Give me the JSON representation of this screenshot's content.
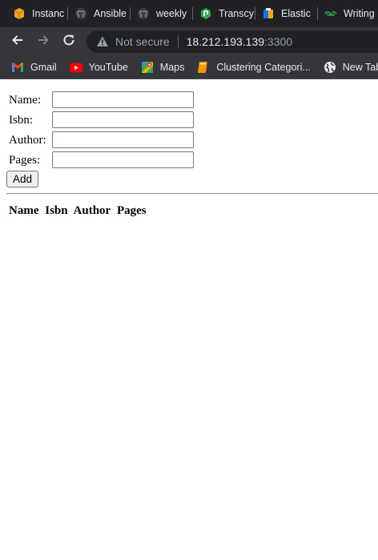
{
  "tabs": [
    {
      "label": "Instanc",
      "icon": "aws-box-icon"
    },
    {
      "label": "Ansible",
      "icon": "github-icon"
    },
    {
      "label": "weekly",
      "icon": "github-icon"
    },
    {
      "label": "Transcy",
      "icon": "transcy-icon"
    },
    {
      "label": "Elastic",
      "icon": "elastic-icon"
    },
    {
      "label": "Writing",
      "icon": "writing-icon"
    }
  ],
  "address": {
    "security_label": "Not secure",
    "host": "18.212.193.139",
    "port": ":3300"
  },
  "bookmarks": [
    {
      "label": "Gmail",
      "icon": "gmail-icon"
    },
    {
      "label": "YouTube",
      "icon": "youtube-icon"
    },
    {
      "label": "Maps",
      "icon": "maps-icon"
    },
    {
      "label": "Clustering Categori...",
      "icon": "book-icon"
    },
    {
      "label": "New Tab",
      "icon": "globe-icon"
    }
  ],
  "form": {
    "name_label": "Name:",
    "isbn_label": "Isbn:",
    "author_label": "Author:",
    "pages_label": "Pages:",
    "name_value": "",
    "isbn_value": "",
    "author_value": "",
    "pages_value": "",
    "add_label": "Add"
  },
  "table": {
    "headers": [
      "Name",
      "Isbn",
      "Author",
      "Pages"
    ]
  },
  "colors": {
    "chrome_dark": "#202124",
    "chrome_toolbar": "#35363a",
    "youtube_red": "#ff0000",
    "aws_orange": "#f5a623"
  }
}
